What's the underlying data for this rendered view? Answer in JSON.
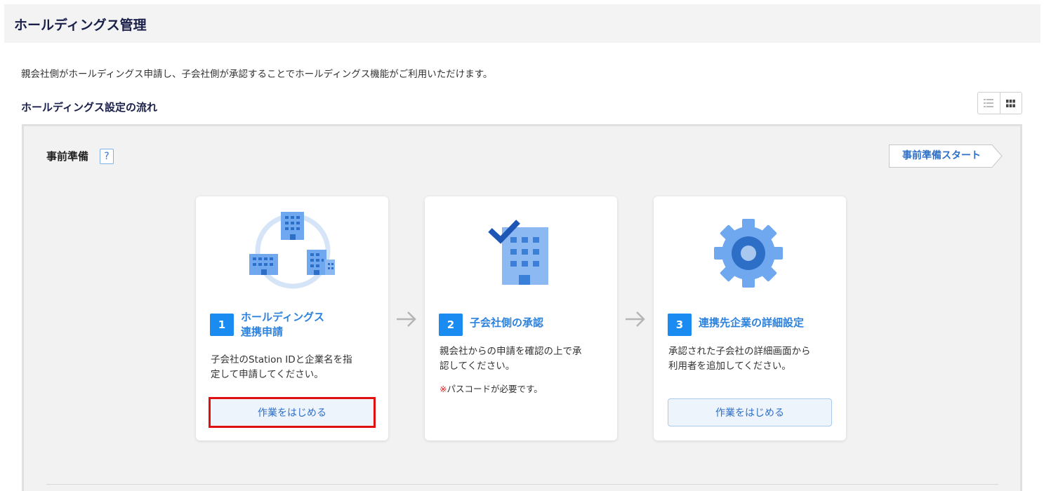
{
  "header": {
    "title": "ホールディングス管理"
  },
  "intro": {
    "text": "親会社側がホールディングス申請し、子会社側が承認することでホールディングス機能がご利用いただけます。"
  },
  "flow": {
    "title": "ホールディングス設定の流れ"
  },
  "view_toggle": {
    "icons": [
      "list-view-icon",
      "grid-view-icon"
    ]
  },
  "prep": {
    "title": "事前準備",
    "help": "?",
    "start_label": "事前準備スタート"
  },
  "steps": [
    {
      "number": "1",
      "title_line1": "ホールディングス",
      "title_line2": "連携申請",
      "desc_line1": "子会社のStation IDと企業名を指",
      "desc_line2": "定して申請してください。",
      "action_label": "作業をはじめる"
    },
    {
      "number": "2",
      "title": "子会社側の承認",
      "desc_line1": "親会社からの申請を確認の上で承",
      "desc_line2": "認してください。",
      "note_mark": "※",
      "note_text": "パスコードが必要です。"
    },
    {
      "number": "3",
      "title": "連携先企業の詳細設定",
      "desc_line1": "承認された子会社の詳細画面から",
      "desc_line2": "利用者を追加してください。",
      "action_label": "作業をはじめる"
    }
  ],
  "colors": {
    "accent": "#1a8bf0",
    "link": "#2d82dd",
    "highlight": "#e01010",
    "illustration": "#6fa8ee"
  }
}
